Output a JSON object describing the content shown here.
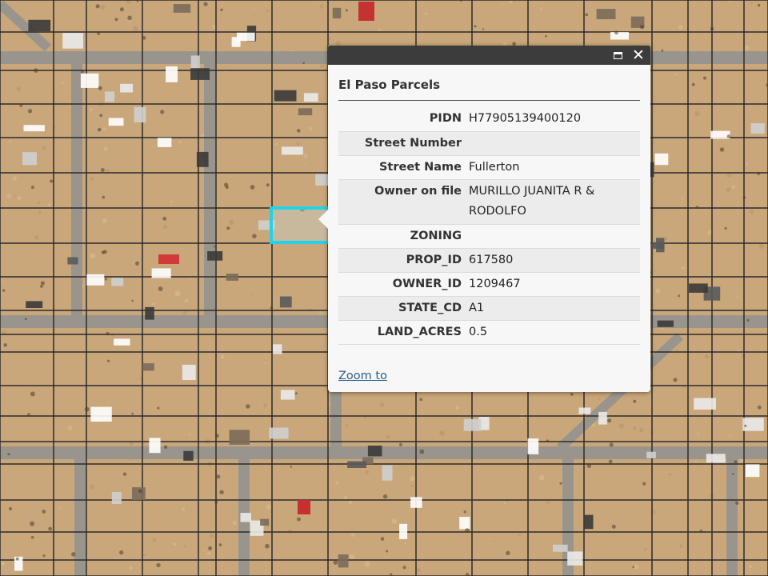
{
  "map": {
    "description_free": true,
    "colors": {
      "ground": "#c9a77a",
      "road": "#9a958c",
      "parcel_line": "#2b2b2b",
      "highlight": "#20d3e8"
    }
  },
  "popup": {
    "title": "El Paso Parcels",
    "maximize_icon": "maximize-icon",
    "close_icon": "close-icon",
    "close_glyph": "✕",
    "fields": [
      {
        "label": "PIDN",
        "value": "H77905139400120"
      },
      {
        "label": "Street Number",
        "value": ""
      },
      {
        "label": "Street Name",
        "value": "Fullerton"
      },
      {
        "label": "Owner on file",
        "value": "MURILLO JUANITA R & RODOLFO"
      },
      {
        "label": "ZONING",
        "value": ""
      },
      {
        "label": "PROP_ID",
        "value": "617580"
      },
      {
        "label": "OWNER_ID",
        "value": "1209467"
      },
      {
        "label": "STATE_CD",
        "value": "A1"
      },
      {
        "label": "LAND_ACRES",
        "value": "0.5"
      }
    ],
    "zoom_label": "Zoom to"
  }
}
